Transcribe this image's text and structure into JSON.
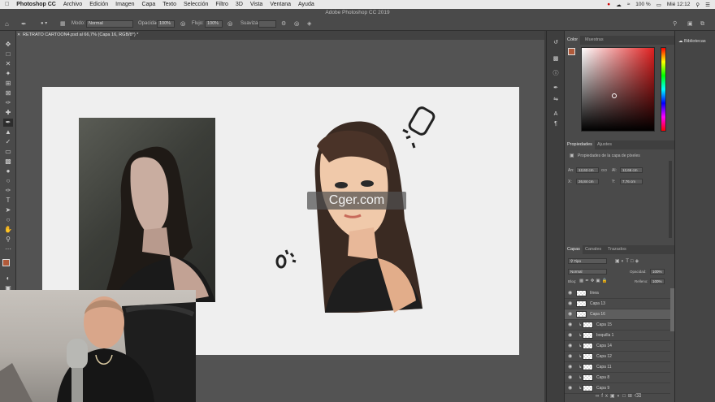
{
  "menubar": {
    "apple_icon": "apple-icon",
    "app": "Photoshop CC",
    "items": [
      "Archivo",
      "Edición",
      "Imagen",
      "Capa",
      "Texto",
      "Selección",
      "Filtro",
      "3D",
      "Vista",
      "Ventana",
      "Ayuda"
    ],
    "battery": "100 %",
    "clock": "Mié 12:12"
  },
  "window": {
    "title": "Adobe Photoshop CC 2019"
  },
  "options": {
    "mode_label": "Modo:",
    "mode_value": "Normal",
    "opacity_label": "Opacidad:",
    "opacity_value": "100%",
    "flow_label": "Flujo:",
    "flow_value": "100%",
    "smooth_label": "Suavizar:",
    "smooth_value": ""
  },
  "document": {
    "tab": "RETRATO CARTOON4.psd al 66,7% (Capa 16, RGB/8*) *"
  },
  "watermark": {
    "text": "Cger.com"
  },
  "libraries": {
    "label": "Bibliotecas"
  },
  "color_panel": {
    "tabs": [
      "Color",
      "Muestras"
    ],
    "hue_color": "#e02020",
    "foreground": "#b05a3a",
    "background": "#ffffff"
  },
  "properties_panel": {
    "tabs": [
      "Propiedades",
      "Ajustes"
    ],
    "subtitle": "Propiedades de la capa de píxeles",
    "w_label": "An:",
    "w_value": "12,63 cm",
    "h_label": "Al:",
    "h_value": "12,66 cm",
    "link_label": "GO",
    "x_label": "X:",
    "x_value": "26,84 cm",
    "y_label": "Y:",
    "y_value": "7,76 cm"
  },
  "layers_panel": {
    "tabs": [
      "Capas",
      "Canales",
      "Trazados"
    ],
    "filter_label": "Tipo",
    "blend_mode": "Normal",
    "opacity_label": "Opacidad:",
    "opacity_value": "100%",
    "lock_label": "Bloq:",
    "fill_label": "Relleno:",
    "fill_value": "100%",
    "layers": [
      {
        "name": "línea",
        "selected": false,
        "clipped": false
      },
      {
        "name": "Capa 13",
        "selected": false,
        "clipped": false
      },
      {
        "name": "Capa 16",
        "selected": true,
        "clipped": false
      },
      {
        "name": "Capa 15",
        "selected": false,
        "clipped": true
      },
      {
        "name": "boquilla 1",
        "selected": false,
        "clipped": true
      },
      {
        "name": "Capa 14",
        "selected": false,
        "clipped": true
      },
      {
        "name": "Capa 12",
        "selected": false,
        "clipped": true
      },
      {
        "name": "Capa 11",
        "selected": false,
        "clipped": true
      },
      {
        "name": "Capa 8",
        "selected": false,
        "clipped": true
      },
      {
        "name": "Capa 9",
        "selected": false,
        "clipped": true
      }
    ],
    "footer_fx": "fx"
  }
}
